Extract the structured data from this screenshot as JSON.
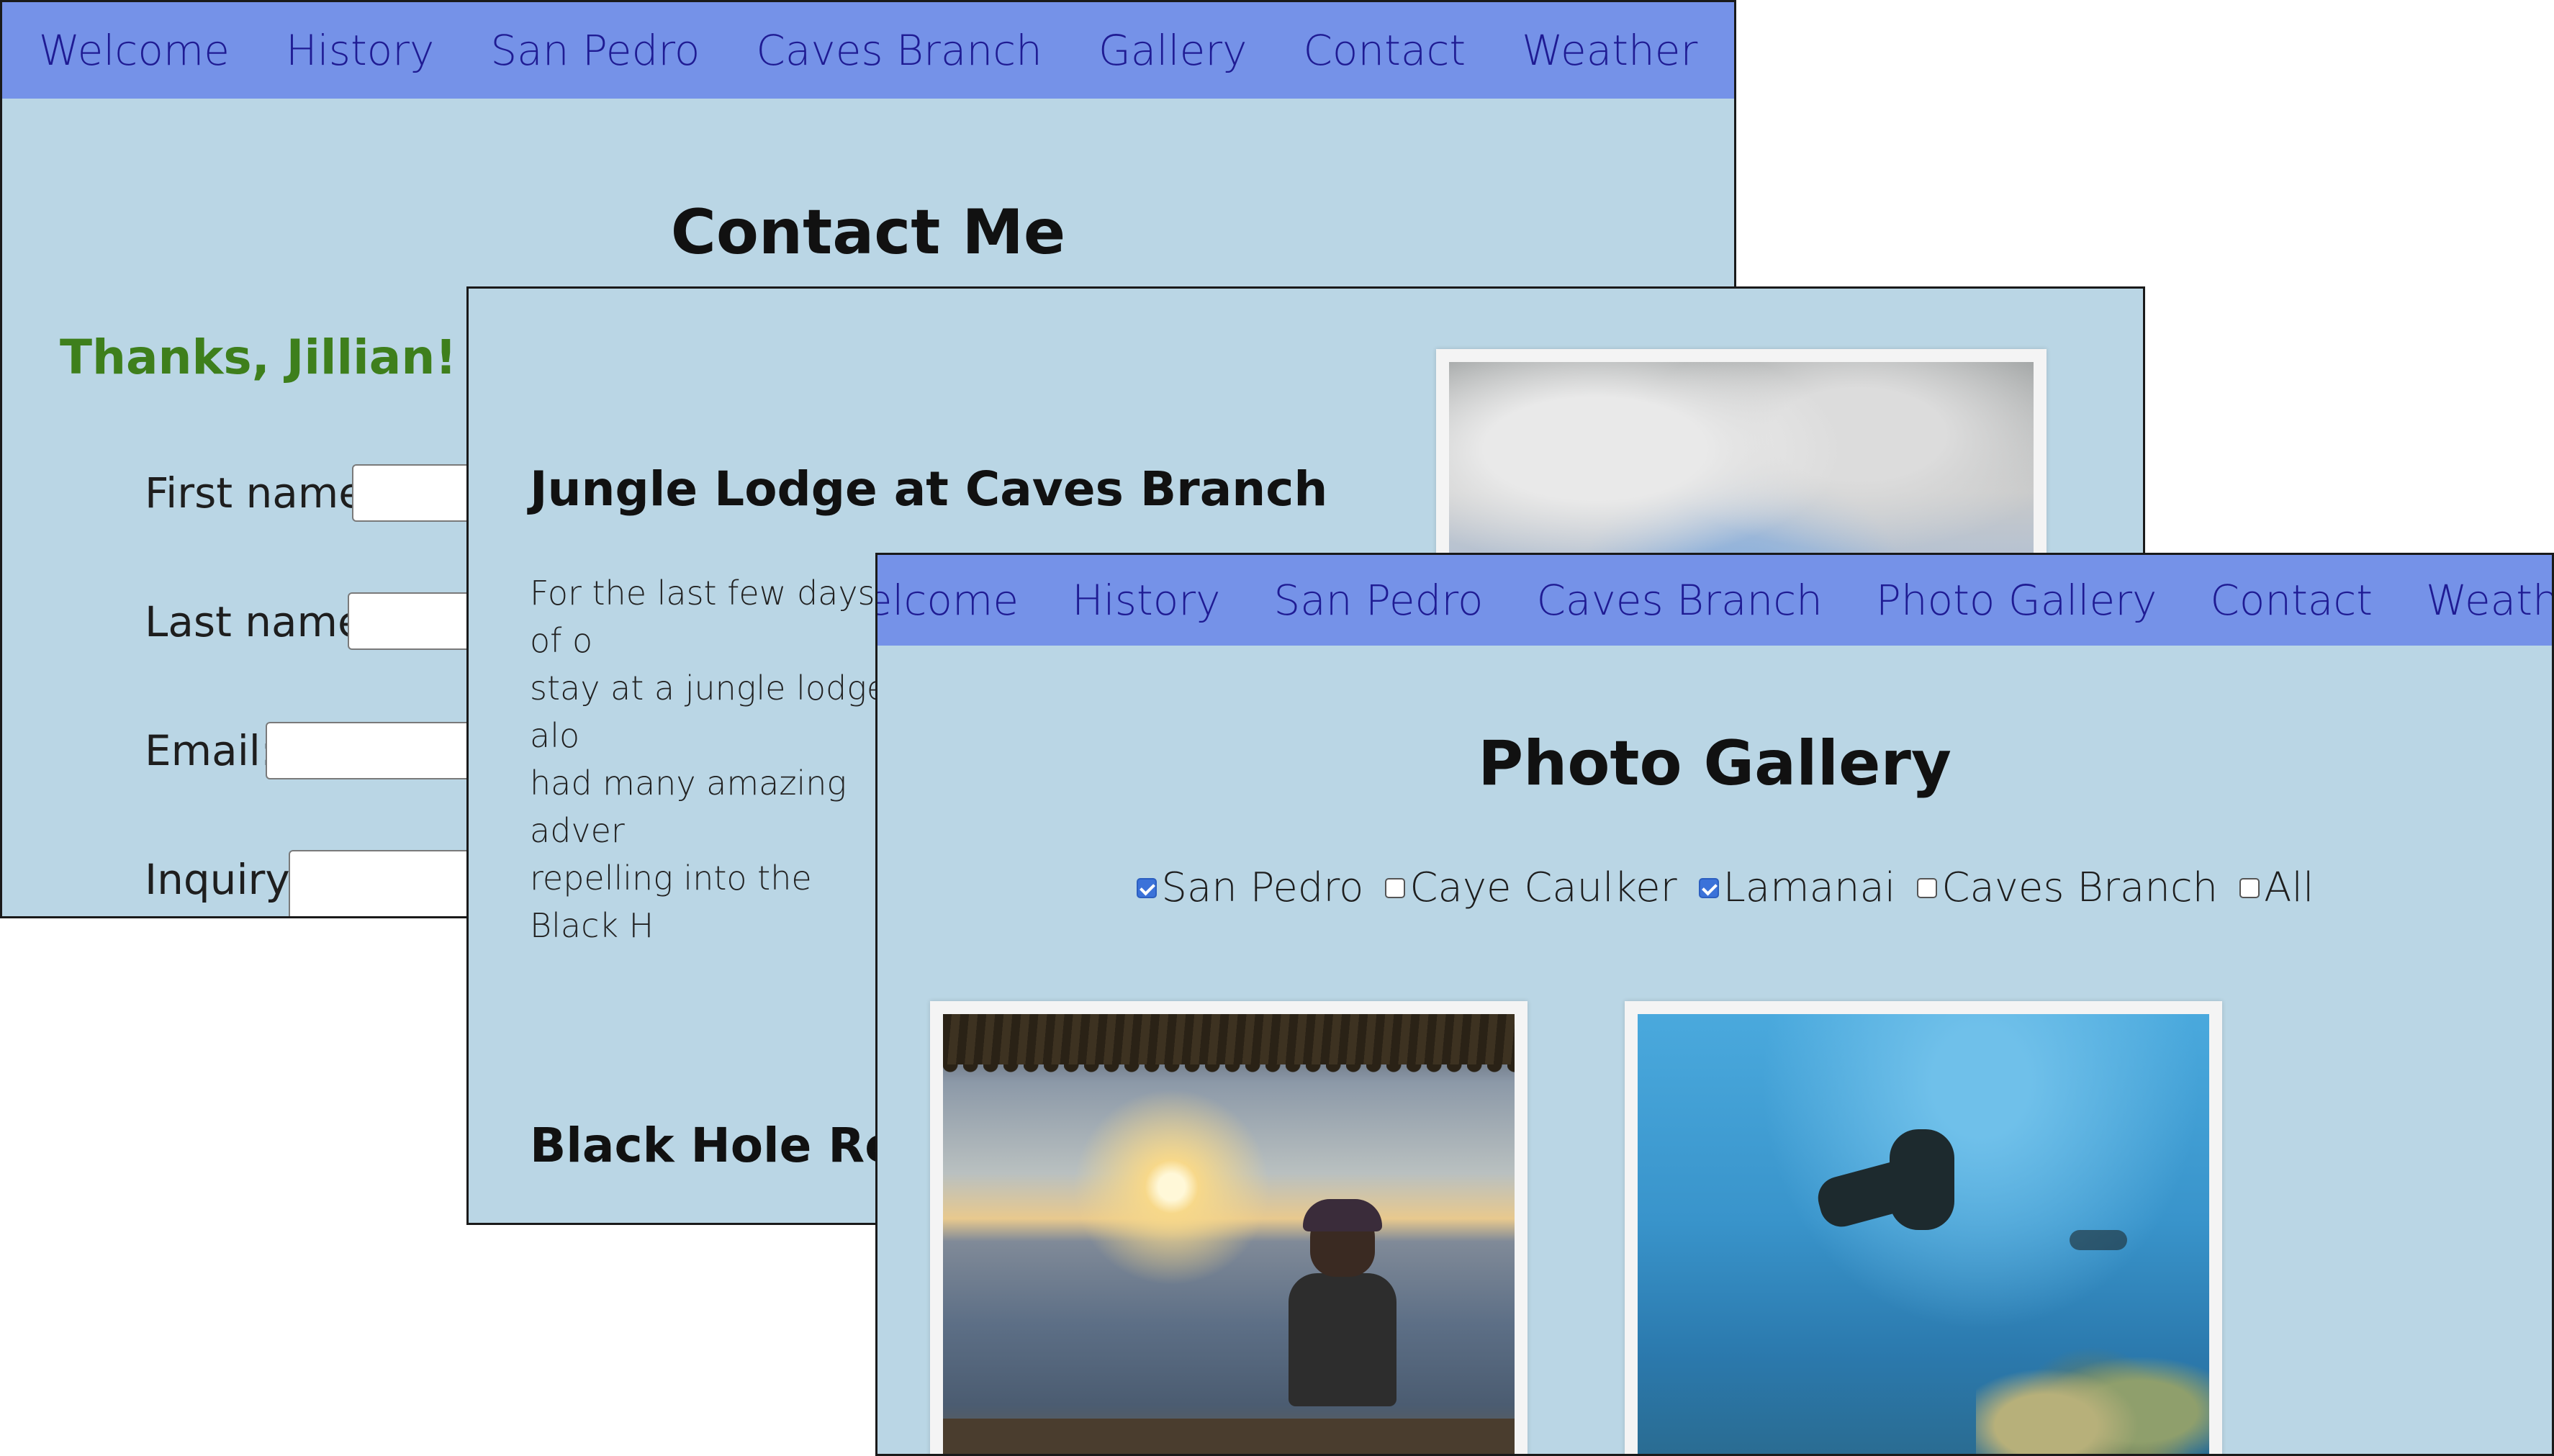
{
  "contact_window": {
    "nav": [
      "Welcome",
      "History",
      "San Pedro",
      "Caves Branch",
      "Gallery",
      "Contact",
      "Weather"
    ],
    "heading": "Contact Me",
    "thanks_text": "Thanks, Jillian! Your i",
    "fields": [
      {
        "label": "First name:",
        "value": ""
      },
      {
        "label": "Last name:",
        "value": ""
      },
      {
        "label": "Email:",
        "value": ""
      },
      {
        "label": "Inquiry:",
        "value": ""
      }
    ]
  },
  "caves_window": {
    "section1_title": "Jungle Lodge at Caves Branch",
    "paragraph_lines": [
      "For the last few days of o",
      "stay at a jungle lodge alo",
      "had many amazing adver",
      "repelling into the Black H"
    ],
    "section2_title": "Black Hole Repelli"
  },
  "gallery_window": {
    "nav": [
      "Welcome",
      "History",
      "San Pedro",
      "Caves Branch",
      "Photo Gallery",
      "Contact",
      "Weather"
    ],
    "heading": "Photo Gallery",
    "filters": [
      {
        "label": "San Pedro",
        "checked": true
      },
      {
        "label": "Caye Caulker",
        "checked": false
      },
      {
        "label": "Lamanai",
        "checked": true
      },
      {
        "label": "Caves Branch",
        "checked": false
      },
      {
        "label": "All",
        "checked": false
      }
    ]
  },
  "colors": {
    "page_bg": "#bad6e5",
    "nav_bg": "#7592e8",
    "nav_text": "#1f1b93",
    "thanks_text": "#3e7f1c",
    "checkbox_on": "#3b72d9"
  }
}
